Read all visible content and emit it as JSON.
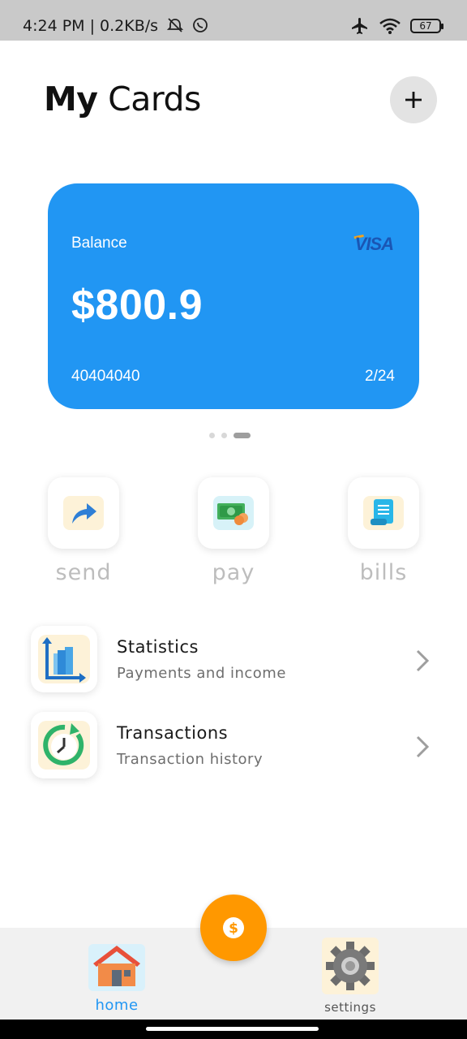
{
  "status_bar": {
    "time_text": "4:24 PM | 0.2KB/s",
    "battery_level": "67",
    "icons": [
      "mute-icon",
      "whatsapp-icon",
      "airplane-icon",
      "wifi-icon",
      "battery-icon"
    ]
  },
  "header": {
    "title_bold": "My",
    "title_rest": "Cards",
    "add_button": "+"
  },
  "card": {
    "balance_label": "Balance",
    "brand": "VISA",
    "amount": "$800.9",
    "number": "40404040",
    "expiry": "2/24",
    "color": "#2196f3"
  },
  "carousel": {
    "count": 3,
    "active_index": 2
  },
  "actions": [
    {
      "label": "send",
      "icon": "send-arrow-icon"
    },
    {
      "label": "pay",
      "icon": "money-icon"
    },
    {
      "label": "bills",
      "icon": "bill-icon"
    }
  ],
  "list": [
    {
      "title": "Statistics",
      "subtitle": "Payments and income",
      "icon": "statistics-chart-icon"
    },
    {
      "title": "Transactions",
      "subtitle": "Transaction history",
      "icon": "history-clock-icon"
    }
  ],
  "bottom_nav": {
    "home_label": "home",
    "settings_label": "settings",
    "fab_icon": "dollar-icon",
    "accent": "#ff9800"
  }
}
